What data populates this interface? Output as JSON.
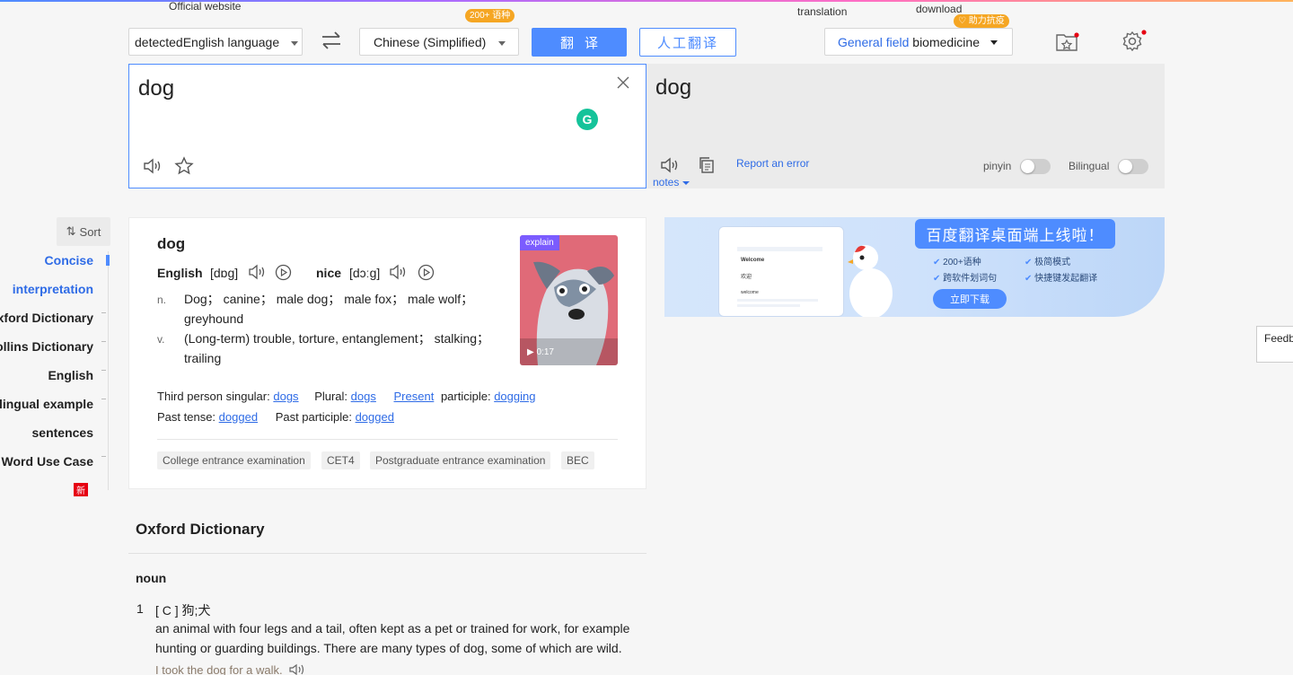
{
  "top": {
    "official_website": "Official website",
    "translation": "translation",
    "download": "download",
    "badge_200": "200+ 语种",
    "badge_fight": "助力抗疫"
  },
  "toolbar": {
    "source_lang": "detectedEnglish language",
    "target_lang": "Chinese (Simplified)",
    "translate_btn": "翻译",
    "human_translate_btn": "人工翻译",
    "field_label": "General field",
    "field_value": "biomedicine"
  },
  "input": {
    "text": "dog"
  },
  "output": {
    "text": "dog",
    "report_error": "Report an error",
    "notes": "notes",
    "pinyin": "pinyin",
    "bilingual": "Bilingual"
  },
  "sidebar": {
    "sort": "Sort",
    "items": [
      {
        "label": "Concise",
        "active": true
      },
      {
        "label": "interpretation",
        "active": true
      },
      {
        "label": "Oxford Dictionary",
        "active": false
      },
      {
        "label": "Collins Dictionary",
        "active": false
      },
      {
        "label": "English",
        "active": false
      },
      {
        "label": "Bilingual example",
        "active": false
      },
      {
        "label": "sentences",
        "active": false
      },
      {
        "label": "Word Use Case",
        "active": false
      }
    ],
    "new_badge": "新"
  },
  "entry": {
    "word": "dog",
    "phon1_label": "English",
    "phon1": "[dɒg]",
    "phon2_label": "nice",
    "phon2": "[dɔːg]",
    "defs": [
      {
        "pos": "n.",
        "line1": "Dog；  canine；  male dog；  male fox；  male wolf；",
        "line2": "greyhound"
      },
      {
        "pos": "v.",
        "line1": "(Long-term) trouble, torture, entanglement；  stalking；",
        "line2": "trailing"
      }
    ],
    "video_tag": "explain",
    "video_time": "0:17",
    "forms": {
      "third_label": "Third person singular:",
      "third": "dogs",
      "plural_label": "Plural:",
      "plural": "dogs",
      "present": "Present",
      "participle_label": "participle:",
      "participle": "dogging",
      "past_label": "Past tense:",
      "past": "dogged",
      "pastp_label": "Past participle:",
      "pastp": "dogged"
    },
    "tags": [
      "College entrance examination",
      "CET4",
      "Postgraduate entrance examination",
      "BEC"
    ]
  },
  "banner": {
    "title": "百度翻译桌面端上线啦！",
    "f1": "200+语种",
    "f2": "极简模式",
    "f3": "跨软件划词句",
    "f4": "快捷键发起翻译",
    "cta": "立即下载",
    "mock_welcome": "Welcome",
    "mock_cn": "欢迎",
    "mock_small": "welcome"
  },
  "feedback": "Feedb",
  "oxford": {
    "title": "Oxford Dictionary",
    "pos": "noun",
    "num": "1",
    "sense": "[ C ] 狗;犬",
    "def1": "an animal with four legs and a tail, often kept as a pet or trained for work, for example",
    "def2": "hunting or guarding buildings. There are many types of dog, some of which are wild.",
    "example": "I took the dog for a walk."
  },
  "colors": {
    "accent": "#4e8cff",
    "orange": "#f5a623",
    "red": "#e60012"
  }
}
